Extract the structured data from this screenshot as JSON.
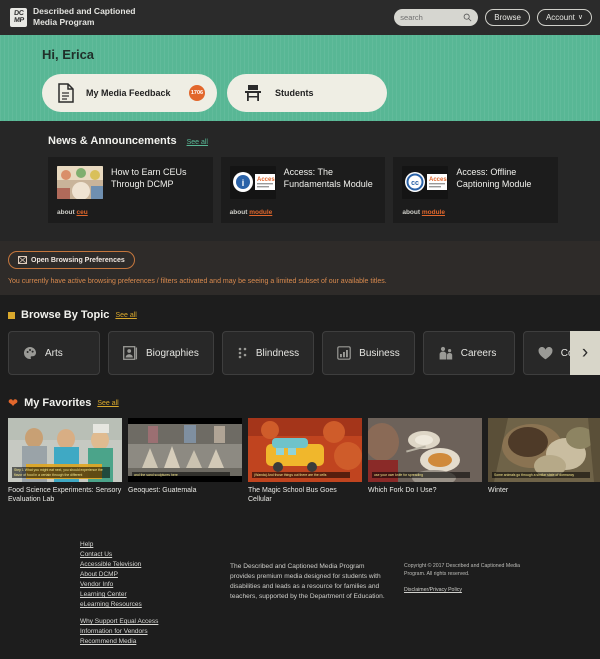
{
  "topnav": {
    "brand_logo": "DC MP",
    "brand_line1": "Described and Captioned",
    "brand_line2": "Media Program",
    "search_placeholder": "search",
    "search_value": "",
    "browse_label": "Browse",
    "account_label": "Account",
    "account_caret": "∨"
  },
  "hero": {
    "greeting": "Hi, Erica",
    "cards": [
      {
        "label": "My Media Feedback",
        "badge": "1706",
        "icon": "document-icon"
      },
      {
        "label": "Students",
        "badge": "",
        "icon": "desk-icon"
      }
    ]
  },
  "news": {
    "title": "News & Announcements",
    "see_all": "See all",
    "cards": [
      {
        "title": "How to Earn CEUs Through DCMP",
        "meta_prefix": "about",
        "meta_link": "ceu"
      },
      {
        "title": "Access: The Fundamentals Module",
        "meta_prefix": "about",
        "meta_link": "module"
      },
      {
        "title": "Access: Offline Captioning Module",
        "meta_prefix": "about",
        "meta_link": "module"
      }
    ]
  },
  "preferences": {
    "button_label": "Open Browsing Preferences",
    "notice": "You currently have active browsing preferences / filters activated and may be seeing a limited subset of our available titles."
  },
  "topics": {
    "title": "Browse By Topic",
    "see_all": "See all",
    "next_arrow": "›",
    "items": [
      {
        "label": "Arts",
        "icon": "palette-icon"
      },
      {
        "label": "Biographies",
        "icon": "portrait-icon"
      },
      {
        "label": "Blindness",
        "icon": "braille-icon"
      },
      {
        "label": "Business",
        "icon": "bar-chart-icon"
      },
      {
        "label": "Careers",
        "icon": "people-icon"
      },
      {
        "label": "Counseling",
        "icon": "heart-icon"
      }
    ]
  },
  "favorites": {
    "title": "My Favorites",
    "see_all": "See all",
    "items": [
      {
        "title": "Food Science Experiments: Sensory Evaluation Lab",
        "caption": "Step 1  What you might eat next, you should experience the flavor of food in a certain through the different"
      },
      {
        "title": "Geoquest: Guatemala",
        "caption": "and the sand sculptures here"
      },
      {
        "title": "The Magic School Bus Goes Cellular",
        "caption": "(Wanda) And those things out there are the cells"
      },
      {
        "title": "Which Fork Do I Use?",
        "caption": "use your own knife for spreading"
      },
      {
        "title": "Winter",
        "caption": "Some animals go through a similar state of dormancy"
      }
    ]
  },
  "footer": {
    "links_group1": [
      "Help",
      "Contact Us",
      "Accessible Television",
      "About DCMP",
      "Vendor Info",
      "Learning Center",
      "eLearning Resources"
    ],
    "links_group2": [
      "Why Support Equal Access",
      "Information for Vendors",
      "Recommend Media"
    ],
    "mission": "The Described and Captioned Media Program provides premium media designed for students with disabilities and leads as a resource for families and teachers, supported by the Department of Education.",
    "copyright": "Copyright © 2017 Described and Captioned Media Program. All rights reserved.",
    "policy_link": "Disclaimer/Privacy Policy"
  },
  "colors": {
    "hero_green": "#58b795",
    "accent_orange": "#e2672c",
    "accent_gold": "#d9a82c",
    "page_bg": "#1d1d1d",
    "nav_bg": "#2b2b2b"
  }
}
